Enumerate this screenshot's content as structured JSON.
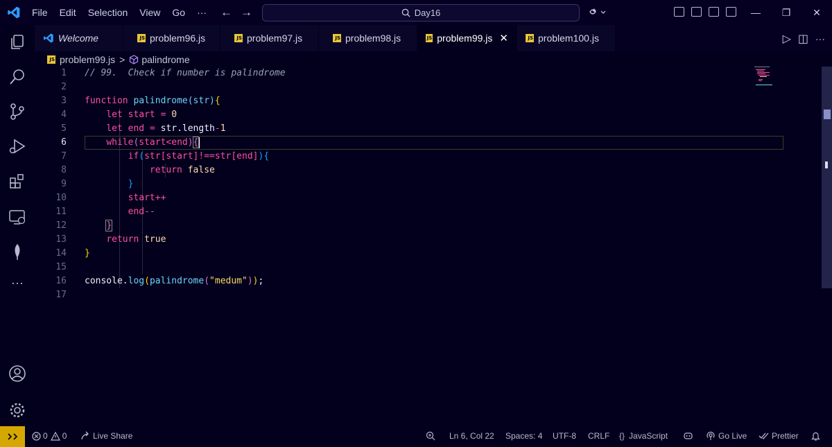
{
  "titlebar": {
    "menu": [
      "File",
      "Edit",
      "Selection",
      "View",
      "Go"
    ],
    "more": "···",
    "back": "←",
    "forward": "→",
    "search_text": "Day16",
    "window": {
      "minimize": "—",
      "restore": "❐",
      "close": "✕"
    }
  },
  "tabs": [
    {
      "label": "Welcome",
      "icon": "vscode-icon"
    },
    {
      "label": "problem96.js",
      "icon": "js-icon"
    },
    {
      "label": "problem97.js",
      "icon": "js-icon"
    },
    {
      "label": "problem98.js",
      "icon": "js-icon"
    },
    {
      "label": "problem99.js",
      "icon": "js-icon",
      "active": true
    },
    {
      "label": "problem100.js",
      "icon": "js-icon"
    }
  ],
  "tab_close": "✕",
  "tab_actions": {
    "run": "▷",
    "split": "◫",
    "more": "···"
  },
  "breadcrumb": {
    "file": "problem99.js",
    "separator": ">",
    "symbol": "palindrome"
  },
  "editor": {
    "line_numbers": [
      "1",
      "2",
      "3",
      "4",
      "5",
      "6",
      "7",
      "8",
      "9",
      "10",
      "11",
      "12",
      "13",
      "14",
      "15",
      "16",
      "17"
    ],
    "current_line": "6",
    "comment": "// 99.  Check if number is palindrome",
    "kw_function": "function",
    "fn_name": "palindrome",
    "param": "(str)",
    "kw_let": "let",
    "var_start": "start",
    "var_end": "end",
    "op_assign": "=",
    "num_zero": "0",
    "str_length": "str.length",
    "op_minus": "-",
    "num_one": "1",
    "kw_while": "while",
    "cond_while": "start<end",
    "kw_if": "if",
    "str_ref": "str",
    "idx_start": "[start]",
    "op_neq": "!==",
    "idx_end": "[end]",
    "kw_return": "return",
    "val_false": "false",
    "val_true": "true",
    "inc": "start++",
    "dec": "end--",
    "console": "console.",
    "log": "log",
    "arg": "\"medum\"",
    "semicolon": ";",
    "brace_open": "{",
    "brace_close": "}",
    "paren_open": "(",
    "paren_close": ")"
  },
  "statusbar": {
    "errors": "0",
    "warnings": "0",
    "live_share": "Live Share",
    "cursor": "Ln 6, Col 22",
    "spaces": "Spaces: 4",
    "encoding": "UTF-8",
    "eol": "CRLF",
    "language": "JavaScript",
    "language_icon": "{}",
    "go_live": "Go Live",
    "prettier": "Prettier"
  },
  "colors": {
    "background": "#02001c",
    "keyword": "#ff4fa0",
    "function": "#6ed2ff",
    "string": "#ffd866",
    "remote_badge": "#d4a800"
  }
}
